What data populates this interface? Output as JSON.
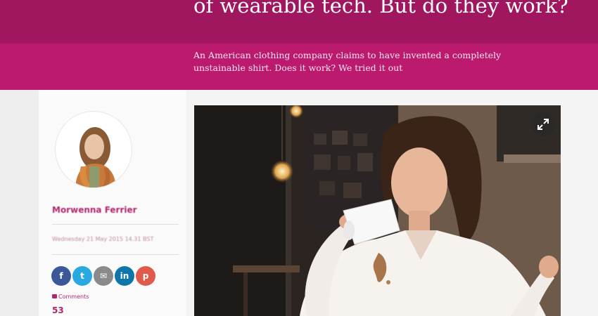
{
  "article": {
    "headline": "of wearable tech. But do they work?",
    "standfirst": "An American clothing company claims to have invented a completely unstainable shirt. Does it work? We tried it out"
  },
  "byline": {
    "author": "Morwenna Ferrier",
    "published": "Wednesday 21 May 2015 14.31 BST"
  },
  "share": {
    "buttons": [
      {
        "name": "facebook",
        "glyph": "f",
        "color": "#3b5998"
      },
      {
        "name": "twitter",
        "glyph": "t",
        "color": "#2aa9e0"
      },
      {
        "name": "email",
        "glyph": "✉",
        "color": "#8a8a8a"
      },
      {
        "name": "linkedin",
        "glyph": "in",
        "color": "#0e76a8"
      },
      {
        "name": "pinterest",
        "glyph": "p",
        "color": "#e05a4b"
      }
    ],
    "comments_label": "Comments",
    "comments_count": "53"
  },
  "colors": {
    "headline_band": "#a0175f",
    "standfirst_band": "#bb1a6e",
    "accent": "#b0276e"
  }
}
